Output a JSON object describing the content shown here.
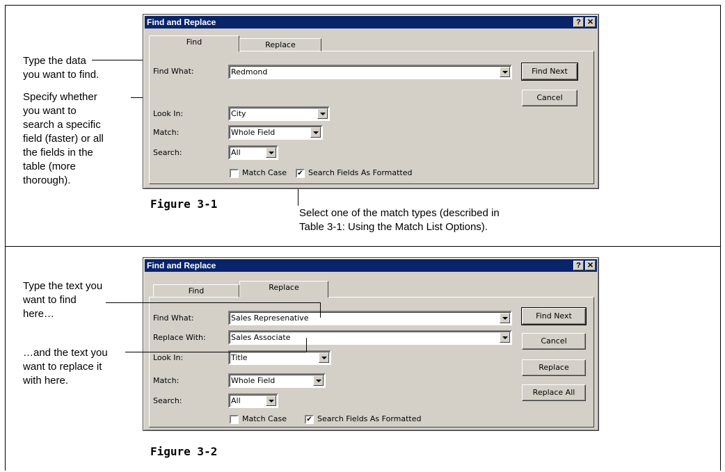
{
  "annotations": {
    "type_data": [
      "Type the data",
      "you want to find."
    ],
    "specify": [
      "Specify whether",
      "you want to",
      "search a specific",
      "field (faster) or all",
      "the fields in the",
      "table (more",
      "thorough)."
    ],
    "select_match": [
      "Select one of the match types (described in",
      "Table 3-1: Using the Match List Options)."
    ],
    "type_text": [
      "Type the text you",
      "want to find",
      "here…"
    ],
    "and_text": [
      "…and the text you",
      "want to replace it",
      "with here."
    ]
  },
  "figures": {
    "fig1": "Figure 3-1",
    "fig2": "Figure 3-2"
  },
  "dialog1": {
    "title": "Find and Replace",
    "tabs": [
      "Find",
      "Replace"
    ],
    "active_tab": "Find",
    "labels": {
      "find_what": "Find What:",
      "look_in": "Look In:",
      "match": "Match:",
      "search": "Search:"
    },
    "values": {
      "find_what": "Redmond",
      "look_in": "City",
      "match": "Whole Field",
      "search": "All"
    },
    "buttons": {
      "find_next": "Find Next",
      "cancel": "Cancel"
    },
    "checkboxes": {
      "match_case": {
        "label": "Match Case",
        "checked": false
      },
      "search_formatted": {
        "label": "Search Fields As Formatted",
        "checked": true
      }
    }
  },
  "dialog2": {
    "title": "Find and Replace",
    "tabs": [
      "Find",
      "Replace"
    ],
    "active_tab": "Replace",
    "labels": {
      "find_what": "Find What:",
      "replace_with": "Replace With:",
      "look_in": "Look In:",
      "match": "Match:",
      "search": "Search:"
    },
    "values": {
      "find_what": "Sales Represenative",
      "replace_with": "Sales Associate",
      "look_in": "Title",
      "match": "Whole Field",
      "search": "All"
    },
    "buttons": {
      "find_next": "Find Next",
      "cancel": "Cancel",
      "replace": "Replace",
      "replace_all": "Replace All"
    },
    "checkboxes": {
      "match_case": {
        "label": "Match Case",
        "checked": false
      },
      "search_formatted": {
        "label": "Search Fields As Formatted",
        "checked": true
      }
    }
  },
  "titlebar_buttons": {
    "help": "?",
    "close": "✕"
  },
  "check_glyph": "✔",
  "colors": {
    "titlebar": "#0a246a",
    "dialog_face": "#d4d0c8"
  }
}
